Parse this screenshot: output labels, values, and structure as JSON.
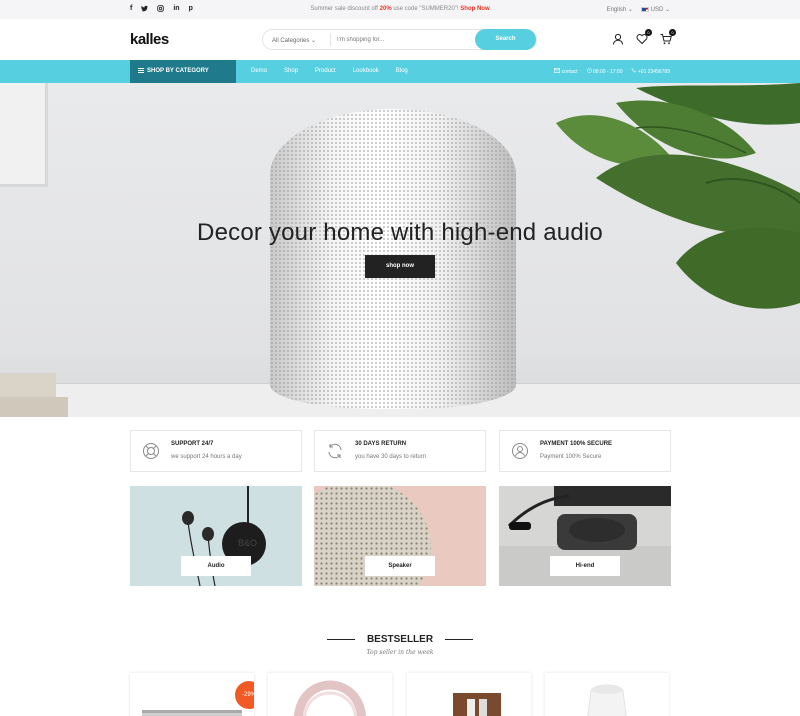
{
  "topbar": {
    "social": [
      "f",
      "t",
      "i",
      "in",
      "p"
    ],
    "promo_prefix": "Summer sale discount off ",
    "promo_percent": "20%",
    "promo_middle": " use code \"SUMMER20\"! ",
    "promo_link": "Shop Now",
    "language": "English ⌄",
    "currency": "USD ⌄"
  },
  "header": {
    "logo": "kalles",
    "search": {
      "category": "All Categories ⌄",
      "placeholder": "I'm shopping for...",
      "button": "Search"
    },
    "wishlist_count": "0",
    "cart_count": "0"
  },
  "nav": {
    "shop_by_category": "SHOP BY CATEGORY",
    "menu": [
      "Demo",
      "Shop",
      "Product",
      "Lookbook",
      "Blog"
    ],
    "contact": "contact",
    "hours": "08:00 - 17:00",
    "phone": "+01 23456789"
  },
  "hero": {
    "headline": "Decor your home with high-end audio",
    "cta": "shop now"
  },
  "features": [
    {
      "title": "SUPPORT 24/7",
      "subtitle": "we support 24 hours a day",
      "icon": "lifebuoy-icon"
    },
    {
      "title": "30 DAYS RETURN",
      "subtitle": "you have 30 days to return",
      "icon": "refresh-icon"
    },
    {
      "title": "PAYMENT 100% SECURE",
      "subtitle": "Payment 100% Secure",
      "icon": "user-shield-icon"
    }
  ],
  "categories": [
    "Audio",
    "Speaker",
    "Hi-end"
  ],
  "bestseller": {
    "title": "BESTSELLER",
    "subtitle": "Top seller in the week",
    "sale_badge": "-29%"
  },
  "colors": {
    "accent": "#56cfe1",
    "nav_dark": "#1f7a8c",
    "sale": "#f15a22"
  }
}
